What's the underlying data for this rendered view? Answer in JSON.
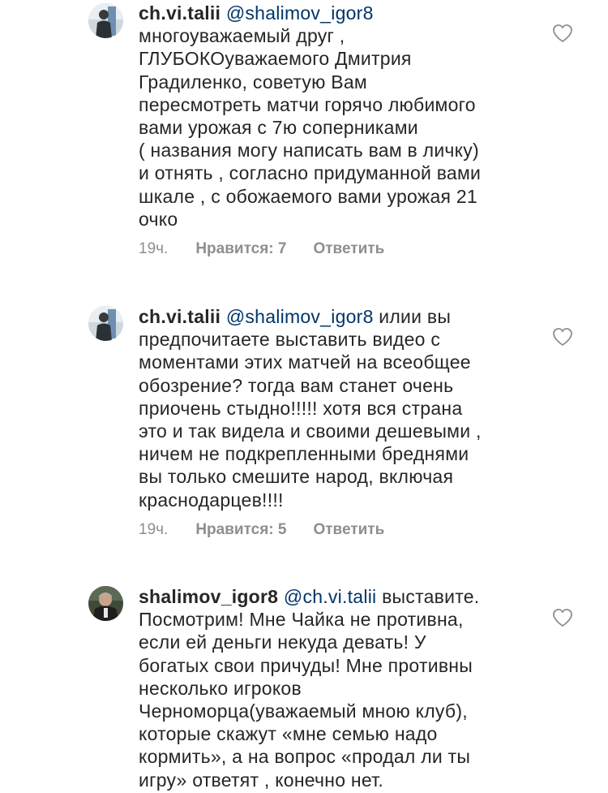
{
  "comments": [
    {
      "username": "ch.vi.talii",
      "mention": "@shalimov_igor8",
      "first_line_rest": "",
      "lines": [
        "многоуважаемый друг ,",
        "ГЛУБОКОуважаемого Дмитрия",
        "Градиленко, советую Вам",
        "пересмотреть матчи горячо любимого",
        "вами урожая с 7ю соперниками",
        "( названия могу написать вам в личку)",
        "и отнять , согласно придуманной вами",
        "шкале , с обожаемого вами урожая 21",
        "очко"
      ],
      "time": "19ч.",
      "likes": "Нравится: 7",
      "reply": "Ответить"
    },
    {
      "username": "ch.vi.talii",
      "mention": "@shalimov_igor8",
      "first_line_rest": "илии вы",
      "lines": [
        "предпочитаете выставить видео с",
        "моментами этих матчей на всеобщее",
        "обозрение? тогда вам станет очень",
        "приочень стыдно!!!!! хотя вся страна",
        "это и так видела и своими дешевыми ,",
        "ничем не подкрепленными бреднями",
        "вы только смешите народ, включая",
        "краснодарцев!!!!"
      ],
      "time": "19ч.",
      "likes": "Нравится: 5",
      "reply": "Ответить"
    },
    {
      "username": "shalimov_igor8",
      "mention": "@ch.vi.talii",
      "first_line_rest": "выставите.",
      "lines": [
        "Посмотрим! Мне Чайка не противна,",
        "если ей деньги некуда девать! У",
        "богатых свои причуды! Мне противны",
        "несколько игроков",
        "Черноморца(уважаемый мною клуб),",
        "которые скажут «мне семью надо",
        "кормить», а на вопрос «продал ли ты",
        "игру» ответят , конечно нет."
      ]
    }
  ],
  "colors": {
    "text": "#262626",
    "mention": "#003569",
    "meta": "#8e8e8e",
    "heart_stroke": "#8e8e8e"
  }
}
